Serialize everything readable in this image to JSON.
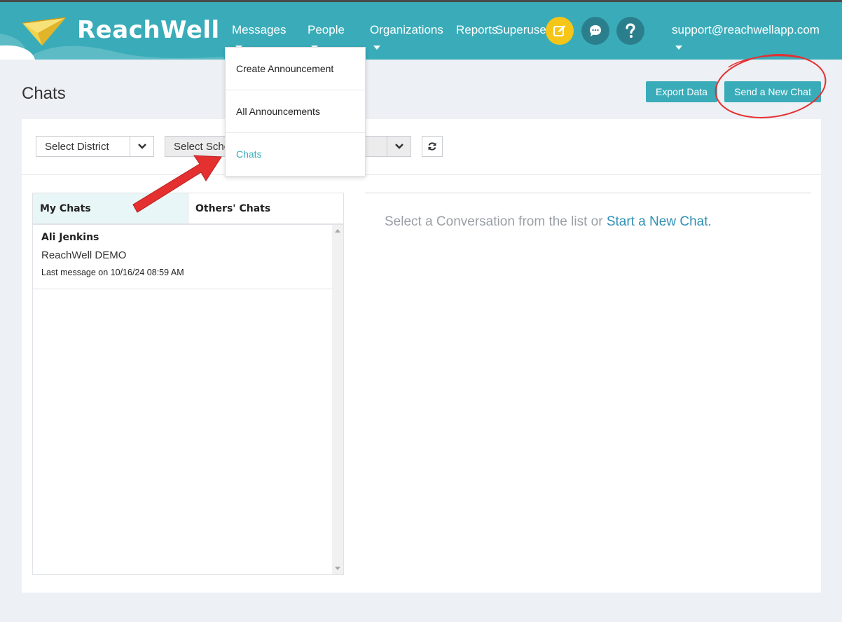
{
  "app": {
    "brand": "ReachWell"
  },
  "nav": {
    "messages": "Messages",
    "people": "People",
    "organizations": "Organizations",
    "reports": "Reports",
    "superuser": "Superuser",
    "user_email": "support@reachwellapp.com"
  },
  "header_icons": [
    {
      "name": "compose-icon",
      "color": "#f5c518"
    },
    {
      "name": "chat-bubble-icon",
      "color": "#2b7f8c"
    },
    {
      "name": "help-icon",
      "color": "#2b7f8c"
    }
  ],
  "messages_menu": {
    "items": [
      "Create Announcement",
      "All Announcements",
      "Chats"
    ],
    "active": "Chats"
  },
  "page": {
    "title": "Chats",
    "export_label": "Export Data",
    "new_chat_label": "Send a New Chat"
  },
  "filters": {
    "district": "Select District",
    "school": "Select Scho"
  },
  "tabs": {
    "mine": "My Chats",
    "others": "Others' Chats"
  },
  "chats": [
    {
      "name": "Ali Jenkins",
      "org": "ReachWell DEMO",
      "last": "Last message on 10/16/24 08:59 AM"
    }
  ],
  "conversation": {
    "prompt": "Select a Conversation from the list or ",
    "link": "Start a New Chat."
  },
  "colors": {
    "brand": "#3aacb9",
    "annotation": "#e53030",
    "link": "#2f8fb5"
  }
}
